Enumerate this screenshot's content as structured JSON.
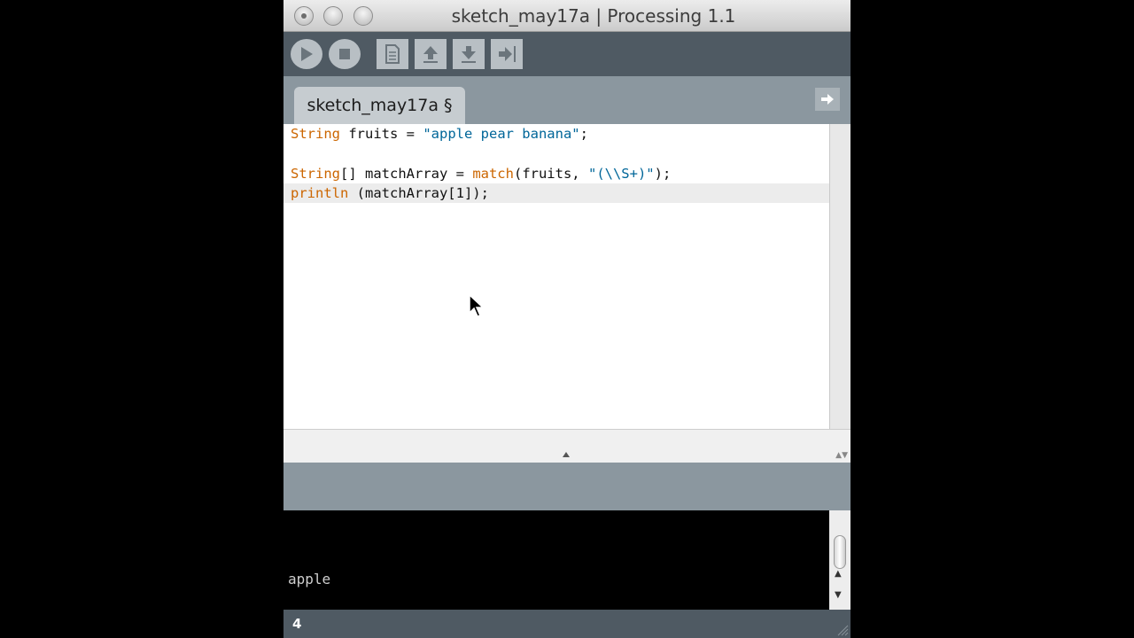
{
  "window": {
    "title": "sketch_may17a | Processing 1.1"
  },
  "toolbar": {
    "buttons": [
      {
        "name": "run",
        "icon": "play-icon"
      },
      {
        "name": "stop",
        "icon": "stop-icon"
      },
      {
        "name": "new",
        "icon": "new-file-icon"
      },
      {
        "name": "open",
        "icon": "upload-arrow-icon"
      },
      {
        "name": "save",
        "icon": "download-arrow-icon"
      },
      {
        "name": "export",
        "icon": "export-arrow-icon"
      }
    ]
  },
  "tabs": {
    "active_label": "sketch_may17a §",
    "menu_icon": "right-arrow-icon"
  },
  "editor": {
    "lines": [
      {
        "segments": [
          {
            "text": "String",
            "type": "kw"
          },
          {
            "text": " fruits = ",
            "type": "plain"
          },
          {
            "text": "\"apple pear banana\"",
            "type": "str"
          },
          {
            "text": ";",
            "type": "plain"
          }
        ]
      },
      {
        "segments": []
      },
      {
        "segments": [
          {
            "text": "String",
            "type": "kw"
          },
          {
            "text": "[] matchArray = ",
            "type": "plain"
          },
          {
            "text": "match",
            "type": "kw"
          },
          {
            "text": "(fruits, ",
            "type": "plain"
          },
          {
            "text": "\"(\\\\S+)\"",
            "type": "str"
          },
          {
            "text": ");",
            "type": "plain"
          }
        ]
      },
      {
        "segments": [
          {
            "text": "println",
            "type": "kw"
          },
          {
            "text": " (matchArray[1]);",
            "type": "plain"
          }
        ]
      }
    ],
    "highlighted_line_index": 3
  },
  "console": {
    "output": "apple"
  },
  "status": {
    "line_number": "4"
  },
  "colors": {
    "keyword": "#cc6600",
    "string": "#006699",
    "toolbar_bg": "#4f5a63",
    "tabstrip_bg": "#8b979f"
  }
}
